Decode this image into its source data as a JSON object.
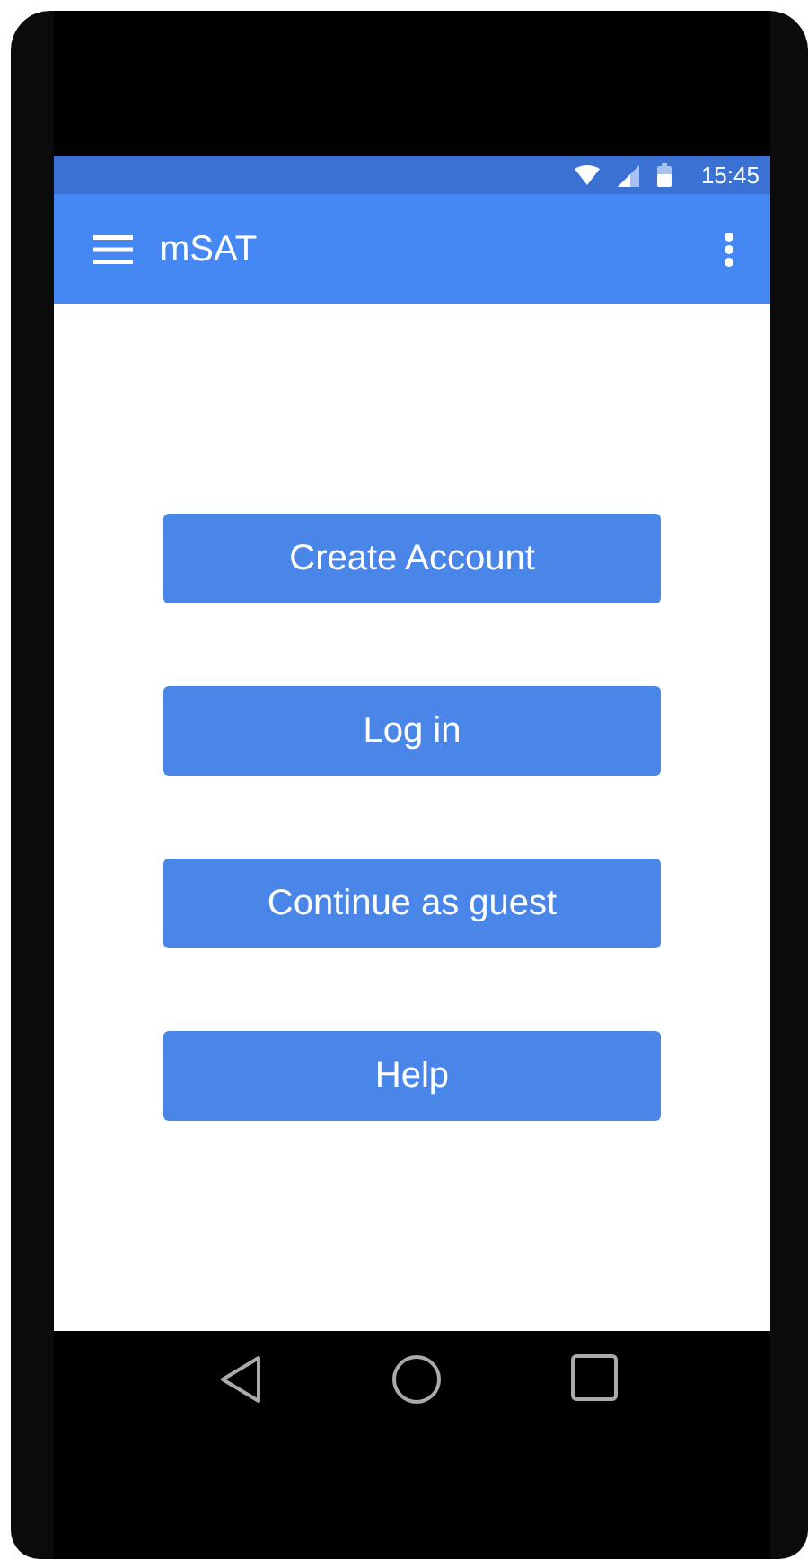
{
  "status_bar": {
    "time": "15:45"
  },
  "app_bar": {
    "title": "mSAT"
  },
  "buttons": [
    {
      "label": "Create Account"
    },
    {
      "label": "Log in"
    },
    {
      "label": "Continue as guest"
    },
    {
      "label": "Help"
    }
  ]
}
